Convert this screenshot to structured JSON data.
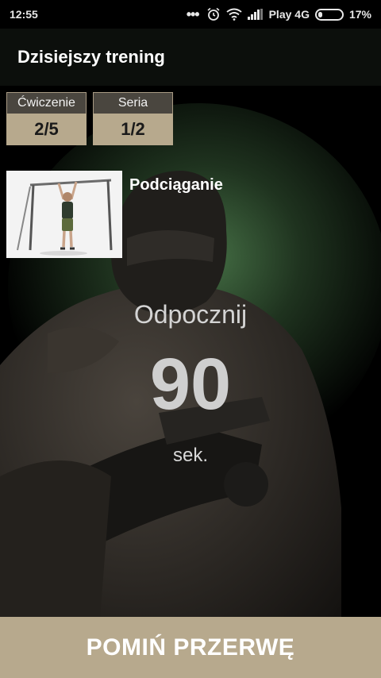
{
  "status_bar": {
    "time": "12:55",
    "dots": "•••",
    "carrier": "Play 4G",
    "battery": "17%",
    "icons": [
      "alarm-icon",
      "wifi-icon",
      "signal-icon",
      "battery-icon"
    ]
  },
  "app_bar": {
    "title": "Dzisiejszy trening"
  },
  "counters": {
    "exercise": {
      "label": "Ćwiczenie",
      "value": "2/5"
    },
    "set": {
      "label": "Seria",
      "value": "1/2"
    }
  },
  "exercise": {
    "name": "Podciąganie"
  },
  "rest": {
    "label": "Odpocznij",
    "count": "90",
    "unit": "sek."
  },
  "skip_button": {
    "label": "POMIŃ PRZERWĘ"
  },
  "colors": {
    "accent": "#b7a98d",
    "label_bg": "#4a463f",
    "glow": "#3f6a3f"
  }
}
